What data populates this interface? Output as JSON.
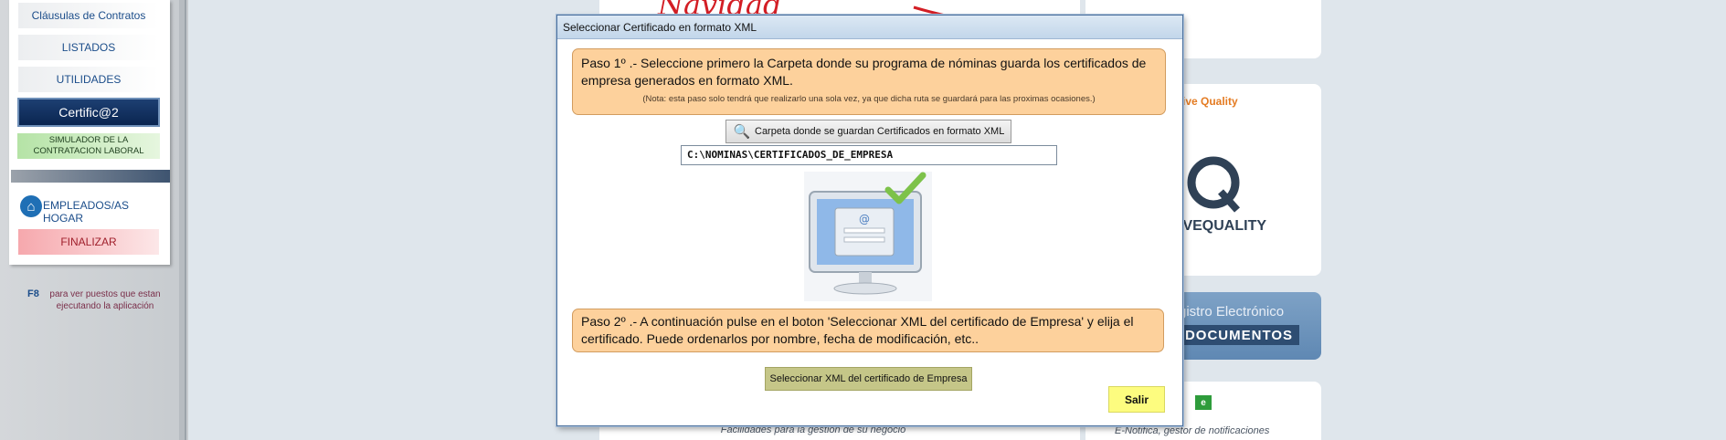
{
  "sidebar": {
    "items": [
      {
        "label": "Cláusulas de Contratos"
      },
      {
        "label": "LISTADOS"
      },
      {
        "label": "UTILIDADES"
      },
      {
        "label": "Certific@2"
      },
      {
        "label": "SIMULADOR DE LA CONTRATACION LABORAL"
      }
    ],
    "hogar_label": "EMPLEADOS/AS HOGAR",
    "finalizar_label": "FINALIZAR",
    "f8_key": "F8",
    "f8_text": "para ver puestos que estan ejecutando la aplicación"
  },
  "background": {
    "navidad": "Navidad",
    "quality_small": "tive Quality",
    "logo_text": "IVEQUALITY",
    "registro": "gistro Electrónico",
    "documentos": "DOCUMENTOS",
    "facilidades": "Facilidades para la gestión de su negocio",
    "enotifica": "E-Notifica, gestor de notificaciones"
  },
  "dialog": {
    "title": "Seleccionar Certificado en formato XML",
    "step1_text": "Paso 1º .-   Seleccione primero la Carpeta donde su programa de nóminas guarda los certificados de empresa generados en formato XML.",
    "step1_note": "(Nota: esta paso solo tendrá que realizarlo una sola vez, ya que dicha ruta se guardará para las proximas ocasiones.)",
    "folder_button": "Carpeta donde se guardan Certificados en formato XML",
    "path_value": "C:\\NOMINAS\\CERTIFICADOS_DE_EMPRESA",
    "step2_text": "Paso 2º .-  A continuación pulse en el boton 'Seleccionar XML del certificado de Empresa' y elija el certificado. Puede ordenarlos por nombre, fecha de modificación, etc..",
    "select_button": "Seleccionar XML del certificado de Empresa",
    "exit_button": "Salir"
  },
  "colors": {
    "note_bg": "#fdd19c",
    "select_btn": "#c5c688",
    "exit_btn": "#fdfc7f",
    "certif_bg": "#0a2550"
  }
}
